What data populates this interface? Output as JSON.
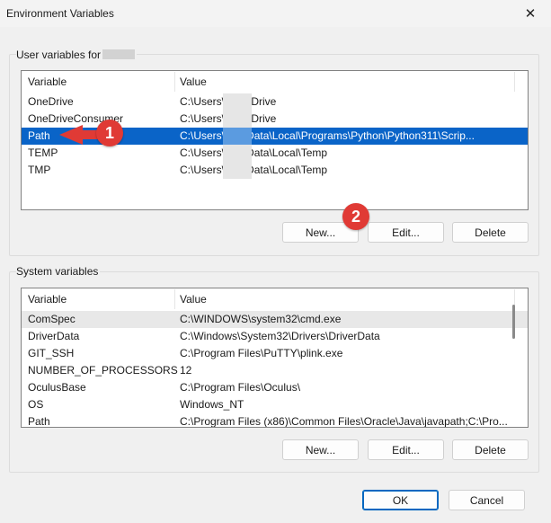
{
  "window": {
    "title": "Environment Variables",
    "close_glyph": "✕"
  },
  "user_group": {
    "label": "User variables for",
    "columns": [
      "Variable",
      "Value"
    ],
    "rows": [
      {
        "variable": "OneDrive",
        "value": "C:\\Users\\       \\OneDrive"
      },
      {
        "variable": "OneDriveConsumer",
        "value": "C:\\Users\\       \\OneDrive"
      },
      {
        "variable": "Path",
        "value": "C:\\Users\\            AppData\\Local\\Programs\\Python\\Python311\\Scrip..."
      },
      {
        "variable": "TEMP",
        "value": "C:\\Users\\            AppData\\Local\\Temp"
      },
      {
        "variable": "TMP",
        "value": "C:\\Users\\            AppData\\Local\\Temp"
      }
    ],
    "buttons": {
      "new": "New...",
      "edit": "Edit...",
      "delete": "Delete"
    }
  },
  "system_group": {
    "label": "System variables",
    "columns": [
      "Variable",
      "Value"
    ],
    "rows": [
      {
        "variable": "ComSpec",
        "value": "C:\\WINDOWS\\system32\\cmd.exe"
      },
      {
        "variable": "DriverData",
        "value": "C:\\Windows\\System32\\Drivers\\DriverData"
      },
      {
        "variable": "GIT_SSH",
        "value": "C:\\Program Files\\PuTTY\\plink.exe"
      },
      {
        "variable": "NUMBER_OF_PROCESSORS",
        "value": "12"
      },
      {
        "variable": "OculusBase",
        "value": "C:\\Program Files\\Oculus\\"
      },
      {
        "variable": "OS",
        "value": "Windows_NT"
      },
      {
        "variable": "Path",
        "value": "C:\\Program Files (x86)\\Common Files\\Oracle\\Java\\javapath;C:\\Pro..."
      }
    ],
    "buttons": {
      "new": "New...",
      "edit": "Edit...",
      "delete": "Delete"
    }
  },
  "footer": {
    "ok": "OK",
    "cancel": "Cancel"
  },
  "annotations": [
    {
      "number": "1"
    },
    {
      "number": "2"
    }
  ],
  "colors": {
    "selection": "#0a64c8",
    "badge": "#e03a35",
    "default_border": "#0067c0"
  }
}
